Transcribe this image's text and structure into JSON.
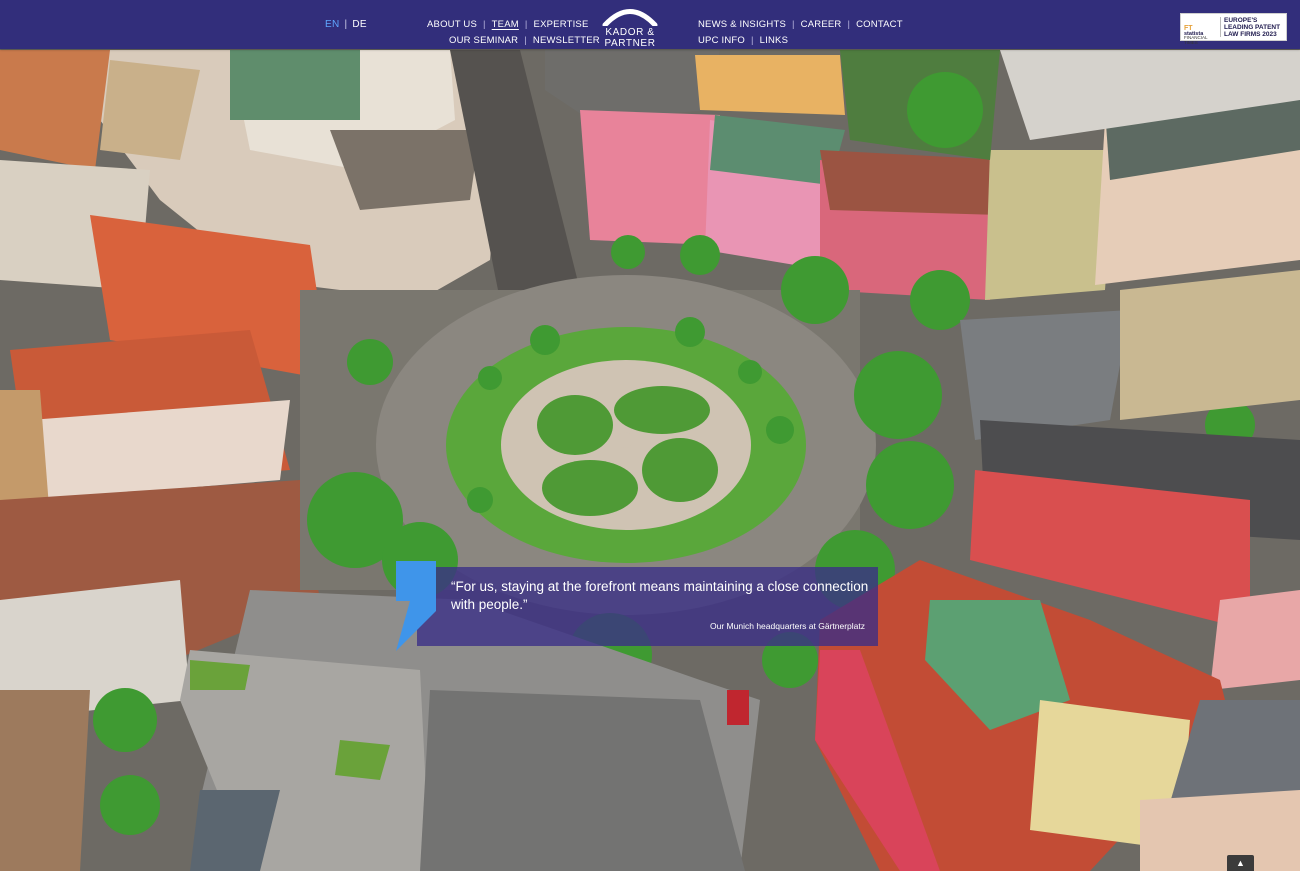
{
  "header": {
    "lang": {
      "en": "EN",
      "de": "DE",
      "active": "EN"
    },
    "nav_left_top": [
      "ABOUT US",
      "TEAM",
      "EXPERTISE"
    ],
    "nav_left_bottom": [
      "OUR SEMINAR",
      "NEWSLETTER"
    ],
    "nav_right_top": [
      "NEWS & INSIGHTS",
      "CAREER",
      "CONTACT"
    ],
    "nav_right_bottom": [
      "UPC INFO",
      "LINKS"
    ],
    "current": "TEAM",
    "logo_text": "KADOR & PARTNER",
    "badge": {
      "ft_mark": "FT",
      "ft_small_1": "FINANCIAL",
      "ft_small_2": "TIMES",
      "statista": "statista",
      "line1": "EUROPE'S",
      "line2": "LEADING PATENT",
      "line3": "LAW FIRMS 2023"
    }
  },
  "quote": {
    "text": "“For us, staying at the forefront means maintaining a close connection with people.”",
    "caption": "Our Munich headquarters at Gärtnerplatz"
  },
  "scroll_top": {
    "icon": "chevron-up-icon"
  },
  "colors": {
    "header_bg": "#322e7b",
    "accent_blue": "#5fa7ff",
    "quote_bg": "#3a2e87",
    "quote_mark": "#3f95ea"
  }
}
